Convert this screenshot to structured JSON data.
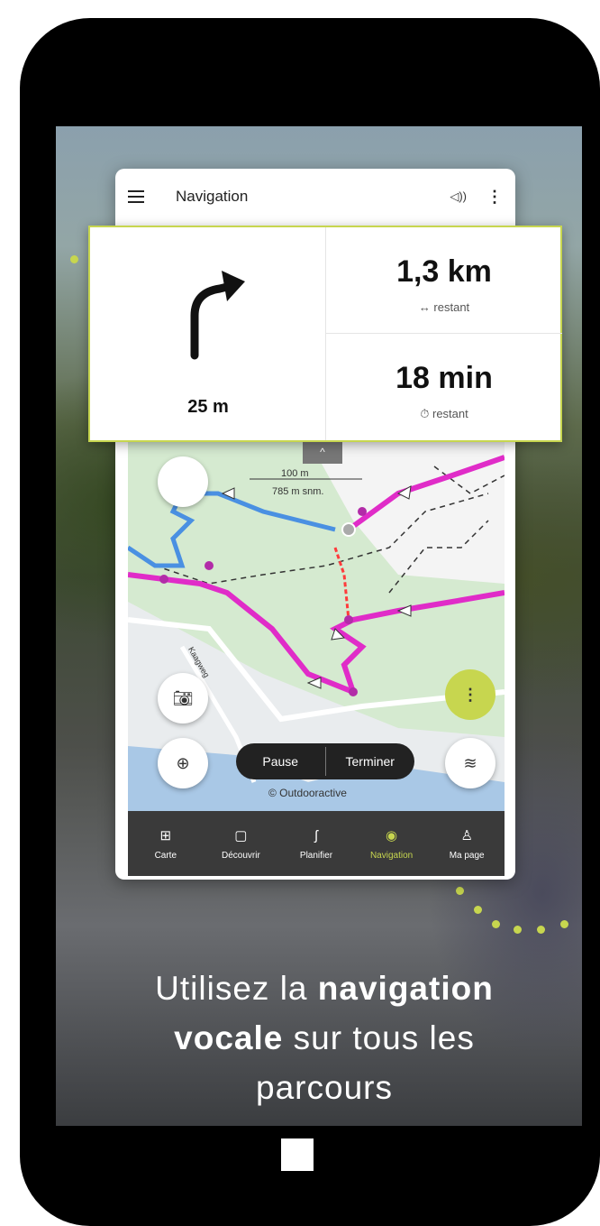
{
  "app": {
    "header_title": "Navigation",
    "sound_icon": "volume-icon",
    "menu_icon": "hamburger-icon",
    "more_icon": "kebab-icon"
  },
  "nav_panel": {
    "turn_distance": "25 m",
    "turn_icon": "turn-right-arrow-icon",
    "distance_value": "1,3 km",
    "distance_label": "↔ restant",
    "time_value": "18 min",
    "time_label": "⏱ restant"
  },
  "map": {
    "scale_text": "100 m",
    "elevation_text": "785 m snm.",
    "attribution": "© Outdooractive",
    "road_label": "Kaagweg",
    "pause_label": "Pause",
    "finish_label": "Terminer"
  },
  "bottom_nav": [
    {
      "label": "Carte",
      "icon": "map-search-icon"
    },
    {
      "label": "Découvrir",
      "icon": "discover-icon"
    },
    {
      "label": "Planifier",
      "icon": "route-plan-icon"
    },
    {
      "label": "Navigation",
      "icon": "navigation-target-icon"
    },
    {
      "label": "Ma page",
      "icon": "user-icon"
    }
  ],
  "headline": {
    "part1": "Utilisez la ",
    "bold1": "navigation",
    "bold2": "vocale",
    "part2": " sur tous les",
    "part3": "parcours"
  },
  "colors": {
    "accent": "#c7d64f",
    "route": "#e02cc8",
    "track": "#4a90e2"
  }
}
